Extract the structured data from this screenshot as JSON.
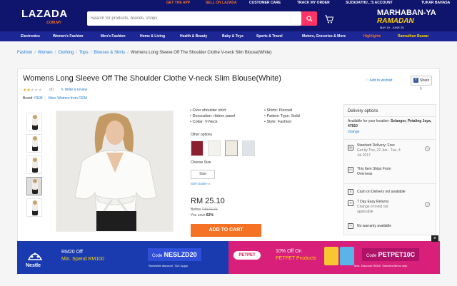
{
  "topstrip": {
    "get_app": "GET THE APP",
    "sell": "SELL ON LAZADA",
    "care": "CUSTOMER CARE",
    "track": "TRACK MY ORDER",
    "user": "SUZADATHU...'S ACCOUNT",
    "lang": "TUKAR BAHASA"
  },
  "header": {
    "logo": "LAZADA",
    "logo_sub": ".COM.MY",
    "search_placeholder": "Search for products, brands, shops",
    "promo_title": "MARHABAN-YA",
    "promo_word": "RAMADAN",
    "promo_dates": "MAY 19 - JUNE 25"
  },
  "categories": [
    {
      "label": "Electronics",
      "type": "normal"
    },
    {
      "label": "Women's Fashion",
      "type": "normal"
    },
    {
      "label": "Men's Fashion",
      "type": "normal"
    },
    {
      "label": "Home & Living",
      "type": "normal"
    },
    {
      "label": "Health & Beauty",
      "type": "normal"
    },
    {
      "label": "Baby & Toys",
      "type": "normal"
    },
    {
      "label": "Sports & Travel",
      "type": "normal"
    },
    {
      "label": "Motors, Groceries & More",
      "type": "normal"
    },
    {
      "label": "Highlights",
      "type": "highlight"
    },
    {
      "label": "Ramadhan Bazaar",
      "type": "bazaar"
    }
  ],
  "breadcrumb": {
    "items": [
      "Fashion",
      "Women",
      "Clothing",
      "Tops",
      "Blouses & Shirts"
    ],
    "current": "Womens Long Sleeve Off The Shoulder Clothe V-neck Slim Blouse(White)"
  },
  "product": {
    "title": "Womens Long Sleeve Off The Shoulder Clothe V-neck Slim Blouse(White)",
    "rating": 2,
    "rating_max": 5,
    "review_count": "(8)",
    "write_review": "Write a review",
    "brand_label": "Brand:",
    "brand": "OEM",
    "more_from": "More Women from OEM",
    "wishlist": "Add to wishlist",
    "share_label": "Share",
    "share_count": "0",
    "specs_left": [
      "Over shoulder shirt:",
      "Decoration: ribbon panel",
      "Collar: V-Neck"
    ],
    "specs_right": [
      "Shirts: Pierced",
      "Pattern Type: Solid",
      "Style: Fashion"
    ],
    "other_options": "Other options",
    "choose_size": "Choose Size",
    "size_value": "Size",
    "size_guide": "Size Guide",
    "price": "RM 25.10",
    "before_label": "Before",
    "before_price": "RM 66.66",
    "save_label": "You save",
    "save_pct": "62%",
    "add_to_cart": "ADD TO CART"
  },
  "delivery": {
    "heading": "Delivery options",
    "available_text": "Available for your location:",
    "location": "Selangor, Petaling Jaya, 47810",
    "change": "change",
    "standard_title": "Standard Delivery: Free",
    "standard_detail_1": "Get by Thu, 22 Jun - Tue, 4",
    "standard_detail_2": "Jul 2017",
    "overseas_1": "This Item Ships From",
    "overseas_2": "Overseas",
    "cod": "Cash on Delivery not available",
    "returns_title": "7 Day Easy Returns",
    "returns_detail_1": "Change of mind not",
    "returns_detail_2": "applicable",
    "warranty": "No warranty available"
  },
  "banner": {
    "nestle": "Nestle",
    "left_off": "RM20 Off",
    "left_min": "Min. Spend RM100",
    "left_code_prefix": "Code",
    "left_code": "NESLZD20",
    "left_tc": "Storewide discount. T&C Apply.",
    "petpet": "PETPET",
    "right_off": "10% Off On",
    "right_products": "PETPET Products",
    "right_code_prefix": "Code",
    "right_code": "PETPET10C",
    "right_tc": "Max. Discount RM20. Selected items only.",
    "close": "×"
  },
  "colors": {
    "brand_navy": "#0f146d",
    "accent_orange": "#f57224",
    "search_pink": "#f36",
    "link_blue": "#1a7bd6"
  }
}
